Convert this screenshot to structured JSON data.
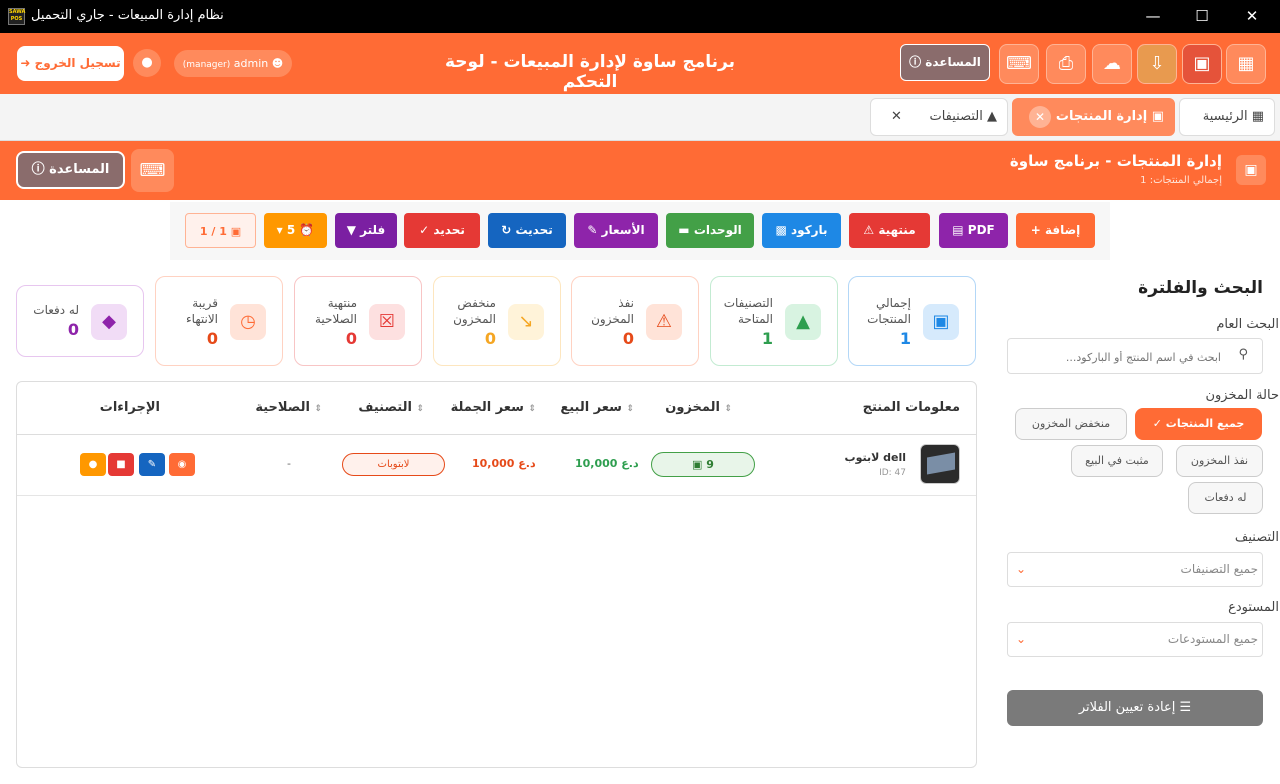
{
  "window": {
    "title": "نظام إدارة المبيعات - جاري التحميل",
    "app_icon_text": "SAWA POS"
  },
  "header": {
    "title": "برنامج ساوة لإدارة المبيعات - لوحة التحكم",
    "help_label": "المساعدة",
    "user_label": "admin",
    "role_label": "(manager)",
    "logout_label": "تسجيل الخروج"
  },
  "tabs": [
    {
      "label": "الرئيسية"
    },
    {
      "label": "إدارة المنتجات"
    },
    {
      "label": "التصنيفات"
    }
  ],
  "section": {
    "title": "إدارة المنتجات - برنامج ساوة",
    "subtitle": "إجمالي المنتجات: 1",
    "help_label": "المساعدة"
  },
  "toolbar": {
    "add": "إضافة",
    "pdf": "PDF",
    "expired": "منتهية",
    "barcode": "باركود",
    "units": "الوحدات",
    "prices": "الأسعار",
    "refresh": "تحديث",
    "select": "تحديد",
    "filter": "فلتر",
    "alerts": "5",
    "pages": "1 / 1"
  },
  "stats": [
    {
      "label": "إجمالي المنتجات",
      "value": "1",
      "color": "#1e88e5"
    },
    {
      "label": "التصنيفات المتاحة",
      "value": "1",
      "color": "#2e9e4f"
    },
    {
      "label": "نفذ المخزون",
      "value": "0",
      "color": "#e64a19"
    },
    {
      "label": "منخفض المخزون",
      "value": "0",
      "color": "#f5a623"
    },
    {
      "label": "منتهية الصلاحية",
      "value": "0",
      "color": "#e53935"
    },
    {
      "label": "قريبة الانتهاء",
      "value": "0",
      "color": "#ff6b35"
    },
    {
      "label": "له دفعات",
      "value": "0",
      "color": "#8e24aa"
    }
  ],
  "table": {
    "headers": [
      "معلومات المنتج",
      "المخزون",
      "سعر البيع",
      "سعر الجملة",
      "التصنيف",
      "الصلاحية",
      "الإجراءات"
    ],
    "rows": [
      {
        "name": "لابتوب dell",
        "id": "ID: 47",
        "stock": "9",
        "sell_price": "10,000 د.ع",
        "wholesale_price": "10,000 د.ع",
        "category": "لابتوبات",
        "expiry": "-"
      }
    ]
  },
  "sidebar": {
    "title": "البحث والفلترة",
    "search_label": "البحث العام",
    "search_placeholder": "ابحث في اسم المنتج أو الباركود...",
    "stock_label": "حالة المخزون",
    "stock_filters": [
      "جميع المنتجات",
      "منخفض المخزون",
      "نفذ المخزون",
      "مثبت في البيع",
      "له دفعات"
    ],
    "category_label": "التصنيف",
    "category_value": "جميع التصنيفات",
    "warehouse_label": "المستودع",
    "warehouse_value": "جميع المستودعات",
    "reset_label": "إعادة تعيين الفلاتر"
  },
  "colors": {
    "brand": "#ff6b35"
  }
}
